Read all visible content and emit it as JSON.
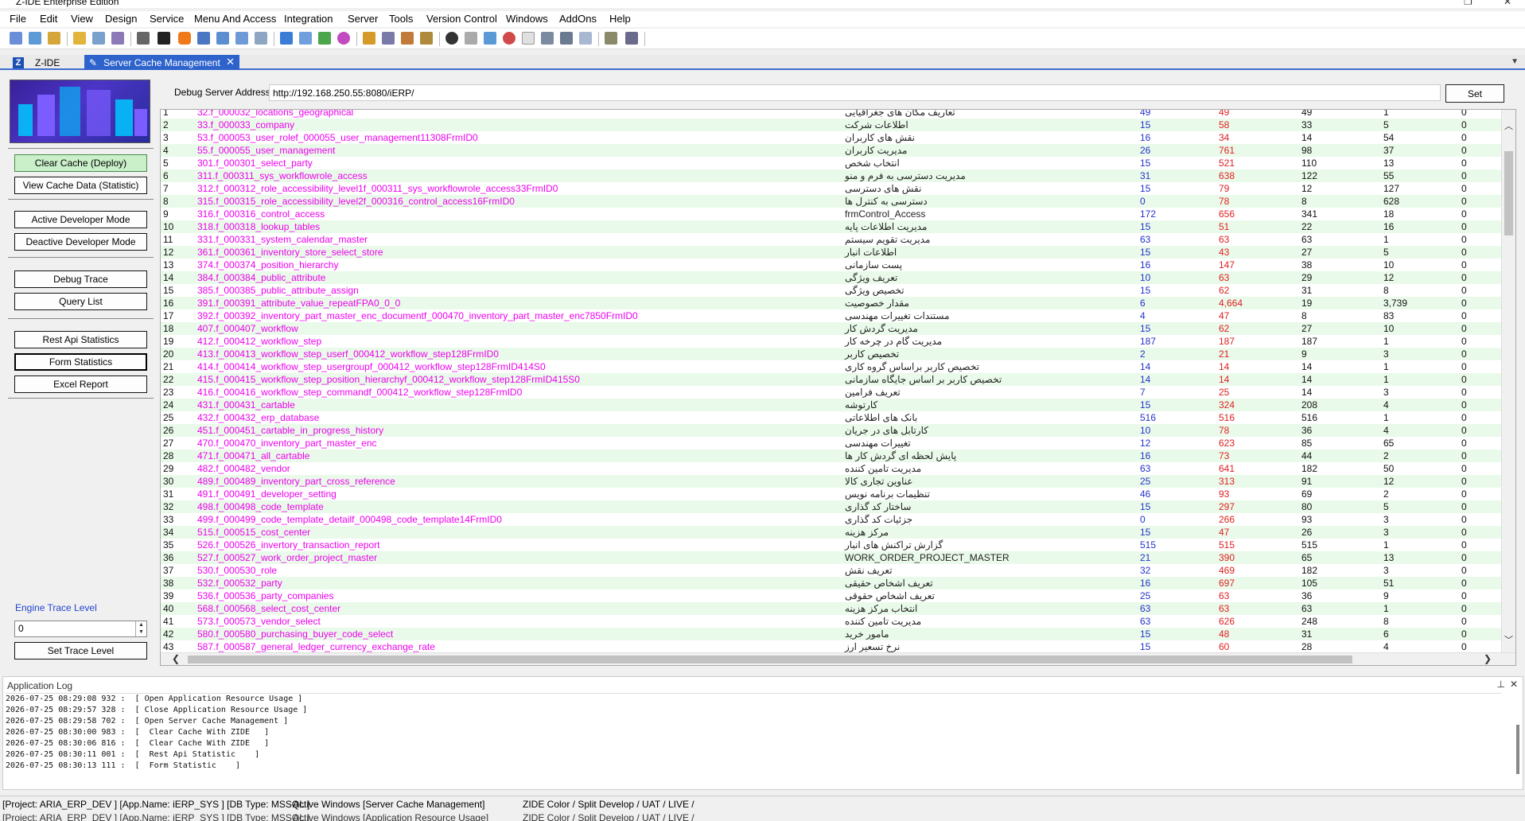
{
  "window": {
    "title": "Z-IDE Enterprise Edition"
  },
  "menu": [
    "File",
    "Edit",
    "View",
    "Design",
    "Service",
    "Menu And Access",
    "Integration",
    "Server",
    "Tools",
    "Version Control",
    "Windows",
    "AddOns",
    "Help"
  ],
  "tabs": {
    "home": "Z-IDE",
    "active": "Server Cache Management"
  },
  "left_panel": {
    "clear_cache": "Clear Cache  (Deploy)",
    "view_cache": "View Cache Data (Statistic)",
    "active_dev": "Active Developer Mode",
    "deactive_dev": "Deactive Developer Mode",
    "debug_trace": "Debug Trace",
    "query_list": "Query List",
    "rest_api": "Rest Api Statistics",
    "form_stats": "Form Statistics",
    "excel": "Excel Report",
    "trace_label": "Engine Trace Level",
    "trace_value": "0",
    "set_trace": "Set Trace Level"
  },
  "debug": {
    "label": "Debug Server Address",
    "value": "http://192.168.250.55:8080/iERP/",
    "set": "Set"
  },
  "grid_rows": [
    [
      "1",
      "32.f_000032_locations_geographical",
      "تعاریف مکان های جغرافیایی",
      "49",
      "49",
      "49",
      "1",
      "0"
    ],
    [
      "2",
      "33.f_000033_company",
      "اطلاعات شرکت",
      "15",
      "58",
      "33",
      "5",
      "0"
    ],
    [
      "3",
      "53.f_000053_user_rolef_000055_user_management11308FrmID0",
      "نقش های کاربران",
      "16",
      "34",
      "14",
      "54",
      "0"
    ],
    [
      "4",
      "55.f_000055_user_management",
      "مدیریت کاربران",
      "26",
      "761",
      "98",
      "37",
      "0"
    ],
    [
      "5",
      "301.f_000301_select_party",
      "انتخاب شخص",
      "15",
      "521",
      "110",
      "13",
      "0"
    ],
    [
      "6",
      "311.f_000311_sys_workflowrole_access",
      "مدیریت دسترسی به فرم و منو",
      "31",
      "638",
      "122",
      "55",
      "0"
    ],
    [
      "7",
      "312.f_000312_role_accessibility_level1f_000311_sys_workflowrole_access33FrmID0",
      "نقش های دسترسی",
      "15",
      "79",
      "12",
      "127",
      "0"
    ],
    [
      "8",
      "315.f_000315_role_accessibility_level2f_000316_control_access16FrmID0",
      "دسترسی به کنترل ها",
      "0",
      "78",
      "8",
      "628",
      "0"
    ],
    [
      "9",
      "316.f_000316_control_access",
      "frmControl_Access",
      "172",
      "656",
      "341",
      "18",
      "0"
    ],
    [
      "10",
      "318.f_000318_lookup_tables",
      "مدیریت اطلاعات پایه",
      "15",
      "51",
      "22",
      "16",
      "0"
    ],
    [
      "11",
      "331.f_000331_system_calendar_master",
      "مدیریت تقویم سیستم",
      "63",
      "63",
      "63",
      "1",
      "0"
    ],
    [
      "12",
      "361.f_000361_inventory_store_select_store",
      "اطلاعات انبار",
      "15",
      "43",
      "27",
      "5",
      "0"
    ],
    [
      "13",
      "374.f_000374_position_hierarchy",
      "پست سازمانی",
      "16",
      "147",
      "38",
      "10",
      "0"
    ],
    [
      "14",
      "384.f_000384_public_attribute",
      "تعریف ویژگی",
      "10",
      "63",
      "29",
      "12",
      "0"
    ],
    [
      "15",
      "385.f_000385_public_attribute_assign",
      "تخصیص ویژگی",
      "15",
      "62",
      "31",
      "8",
      "0"
    ],
    [
      "16",
      "391.f_000391_attribute_value_repeatFPA0_0_0",
      "مقدار خصوصیت",
      "6",
      "4,664",
      "19",
      "3,739",
      "0"
    ],
    [
      "17",
      "392.f_000392_inventory_part_master_enc_documentf_000470_inventory_part_master_enc7850FrmID0",
      "مستندات تغییرات مهندسی",
      "4",
      "47",
      "8",
      "83",
      "0"
    ],
    [
      "18",
      "407.f_000407_workflow",
      "مدیریت گردش کار",
      "15",
      "62",
      "27",
      "10",
      "0"
    ],
    [
      "19",
      "412.f_000412_workflow_step",
      "مدیریت گام در چرخه کار",
      "187",
      "187",
      "187",
      "1",
      "0"
    ],
    [
      "20",
      "413.f_000413_workflow_step_userf_000412_workflow_step128FrmID0",
      "تخصیص کاربر",
      "2",
      "21",
      "9",
      "3",
      "0"
    ],
    [
      "21",
      "414.f_000414_workflow_step_usergroupf_000412_workflow_step128FrmID414S0",
      "تخصیص کاربر براساس گروه کاری",
      "14",
      "14",
      "14",
      "1",
      "0"
    ],
    [
      "22",
      "415.f_000415_workflow_step_position_hierarchyf_000412_workflow_step128FrmID415S0",
      "تخصیص کاربر بر اساس جایگاه سازمانی",
      "14",
      "14",
      "14",
      "1",
      "0"
    ],
    [
      "23",
      "416.f_000416_workflow_step_commandf_000412_workflow_step128FrmID0",
      "تعریف فرامین",
      "7",
      "25",
      "14",
      "3",
      "0"
    ],
    [
      "24",
      "431.f_000431_cartable",
      "کارتوشه",
      "15",
      "324",
      "208",
      "4",
      "0"
    ],
    [
      "25",
      "432.f_000432_erp_database",
      "بانک های اطلاعاتی",
      "516",
      "516",
      "516",
      "1",
      "0"
    ],
    [
      "26",
      "451.f_000451_cartable_in_progress_history",
      "کارتابل های در جریان",
      "10",
      "78",
      "36",
      "4",
      "0"
    ],
    [
      "27",
      "470.f_000470_inventory_part_master_enc",
      "تغییرات مهندسی",
      "12",
      "623",
      "85",
      "65",
      "0"
    ],
    [
      "28",
      "471.f_000471_all_cartable",
      "پایش لحظه ای گردش کار ها",
      "16",
      "73",
      "44",
      "2",
      "0"
    ],
    [
      "29",
      "482.f_000482_vendor",
      "مدیریت تامین کننده",
      "63",
      "641",
      "182",
      "50",
      "0"
    ],
    [
      "30",
      "489.f_000489_inventory_part_cross_reference",
      "عناوین تجاری کالا",
      "25",
      "313",
      "91",
      "12",
      "0"
    ],
    [
      "31",
      "491.f_000491_developer_setting",
      "تنظیمات برنامه نویس",
      "46",
      "93",
      "69",
      "2",
      "0"
    ],
    [
      "32",
      "498.f_000498_code_template",
      "ساختار کد گذاری",
      "15",
      "297",
      "80",
      "5",
      "0"
    ],
    [
      "33",
      "499.f_000499_code_template_detailf_000498_code_template14FrmID0",
      "جزئیات کد گذاری",
      "0",
      "266",
      "93",
      "3",
      "0"
    ],
    [
      "34",
      "515.f_000515_cost_center",
      "مرکز هزینه",
      "15",
      "47",
      "26",
      "3",
      "0"
    ],
    [
      "35",
      "526.f_000526_invertory_transaction_report",
      "گزارش تراکنش های انبار",
      "515",
      "515",
      "515",
      "1",
      "0"
    ],
    [
      "36",
      "527.f_000527_work_order_project_master",
      "WORK_ORDER_PROJECT_MASTER",
      "21",
      "390",
      "65",
      "13",
      "0"
    ],
    [
      "37",
      "530.f_000530_role",
      "تعریف نقش",
      "32",
      "469",
      "182",
      "3",
      "0"
    ],
    [
      "38",
      "532.f_000532_party",
      "تعریف اشخاص حقیقی",
      "16",
      "697",
      "105",
      "51",
      "0"
    ],
    [
      "39",
      "536.f_000536_party_companies",
      "تعریف اشخاص حقوقی",
      "25",
      "63",
      "36",
      "9",
      "0"
    ],
    [
      "40",
      "568.f_000568_select_cost_center",
      "انتخاب مرکز هزینه",
      "63",
      "63",
      "63",
      "1",
      "0"
    ],
    [
      "41",
      "573.f_000573_vendor_select",
      "مدیریت تامین کننده",
      "63",
      "626",
      "248",
      "8",
      "0"
    ],
    [
      "42",
      "580.f_000580_purchasing_buyer_code_select",
      "مامور خرید",
      "15",
      "48",
      "31",
      "6",
      "0"
    ],
    [
      "43",
      "587.f_000587_general_ledger_currency_exchange_rate",
      "نرخ تسعیر ارز",
      "15",
      "60",
      "28",
      "4",
      "0"
    ]
  ],
  "log": {
    "title": "Application Log",
    "lines": [
      "2026-07-25 08:29:08 932 :  [ Open Application Resource Usage ]",
      "2026-07-25 08:29:57 328 :  [ Close Application Resource Usage ]",
      "2026-07-25 08:29:58 702 :  [ Open Server Cache Management ]",
      "2026-07-25 08:30:00 983 :  [  Clear Cache With ZIDE   ]",
      "2026-07-25 08:30:06 816 :  [  Clear Cache With ZIDE   ]",
      "2026-07-25 08:30:11 001 :  [  Rest Api Statistic    ]",
      "2026-07-25 08:30:13 111 :  [  Form Statistic    ]"
    ]
  },
  "status": {
    "project": "[Project: ARIA_ERP_DEV ] [App.Name: iERP_SYS ] [DB Type: MSSQL ]",
    "active1": "Active Windows [Server Cache Management]",
    "mode": "ZIDE Color / Split  Develop  /  UAT / LIVE /",
    "active2": "Active Windows [Application Resource Usage]"
  },
  "colors": {
    "tab_active": "#2e63cc",
    "form_name": "#ee00ee",
    "count_blue": "#2233cc",
    "count_red": "#e02020",
    "row_alt": "#eafaea",
    "btn_green": "#c9f0c9"
  }
}
